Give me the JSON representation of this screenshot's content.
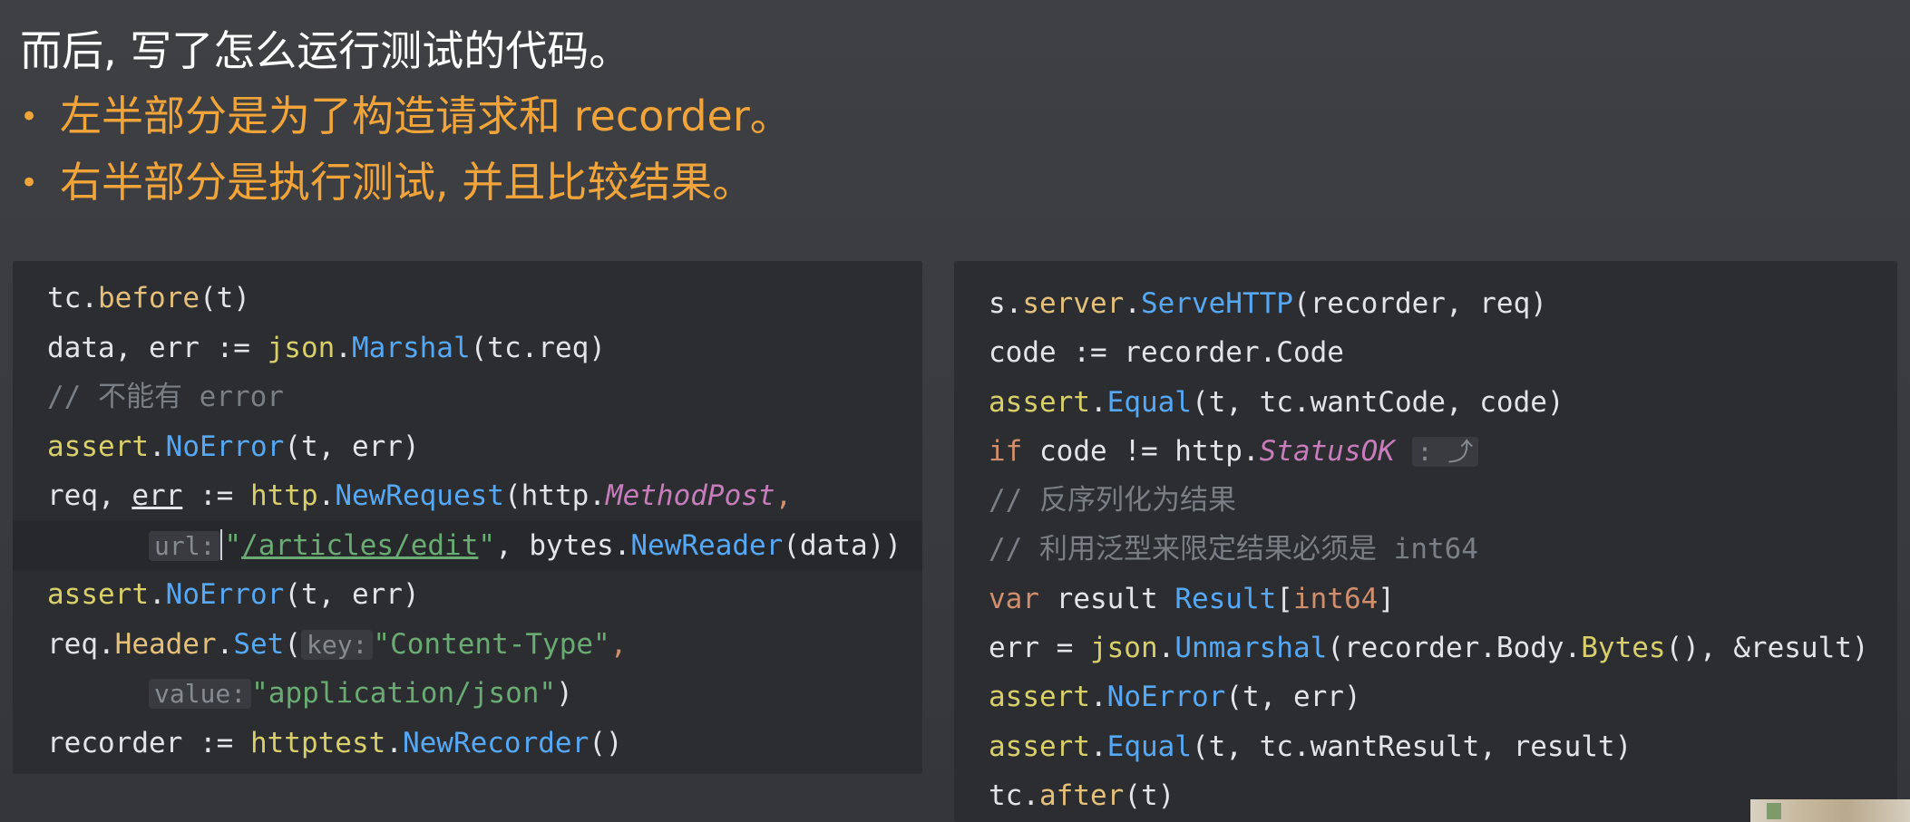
{
  "slide": {
    "heading": "而后, 写了怎么运行测试的代码。",
    "bullets": [
      {
        "bullet": "•",
        "text": "左半部分是为了构造请求和 recorder。"
      },
      {
        "bullet": "•",
        "text": "右半部分是执行测试, 并且比较结果。"
      }
    ]
  },
  "colors": {
    "accent_orange": "#f0a43a",
    "panel_bg": "#2b2d30",
    "keyword": "#cf8e6d",
    "string": "#6aab73",
    "comment": "#7a7e85"
  },
  "left_code": {
    "l1": {
      "a": "tc.",
      "b": "before",
      "c": "(t)"
    },
    "l2": {
      "a": "data, err := ",
      "b": "json",
      "c": ".",
      "d": "Marshal",
      "e": "(tc.req)"
    },
    "l3": {
      "a": "// 不能有 error"
    },
    "l4": {
      "a": "assert",
      "b": ".",
      "c": "NoError",
      "d": "(t, err)"
    },
    "l5": {
      "a": "req, ",
      "b": "err",
      "c": " := ",
      "d": "http",
      "e": ".",
      "f": "NewRequest",
      "g": "(http.",
      "h": "MethodPost",
      "i": ","
    },
    "l6": {
      "hint": "url:",
      "q1": "\"",
      "a": "/articles/edit",
      "q2": "\"",
      "b": ", bytes.",
      "c": "NewReader",
      "d": "(data))"
    },
    "l7": {
      "a": "assert",
      "b": ".",
      "c": "NoError",
      "d": "(t, err)"
    },
    "l8": {
      "a": "req.",
      "b": "Header",
      "c": ".",
      "d": "Set",
      "e": "(",
      "hint": "key:",
      "f": "\"Content-Type\"",
      "g": ","
    },
    "l9": {
      "hint": "value:",
      "a": "\"application/json\"",
      "b": ")"
    },
    "l10": {
      "a": "recorder := ",
      "b": "httptest",
      "c": ".",
      "d": "NewRecorder",
      "e": "()"
    }
  },
  "right_code": {
    "r1": {
      "a": "s.",
      "b": "server",
      "c": ".",
      "d": "ServeHTTP",
      "e": "(recorder, req)"
    },
    "r2": {
      "a": "code := recorder.",
      "b": "Code"
    },
    "r3": {
      "a": "assert",
      "b": ".",
      "c": "Equal",
      "d": "(t, tc.wantCode, code)"
    },
    "r4": {
      "a": "if",
      "b": " code != http.",
      "c": "StatusOK",
      "hint": ":",
      "arrow": "⤴"
    },
    "r5": {
      "a": "// 反序列化为结果"
    },
    "r6": {
      "a": "// 利用泛型来限定结果必须是 int64"
    },
    "r7": {
      "a": "var",
      "b": " result ",
      "c": "Result",
      "d": "[",
      "e": "int64",
      "f": "]"
    },
    "r8": {
      "a": "err = ",
      "b": "json",
      "c": ".",
      "d": "Unmarshal",
      "e": "(recorder.Body.",
      "f": "Bytes",
      "g": "(), &result)"
    },
    "r9": {
      "a": "assert",
      "b": ".",
      "c": "NoError",
      "d": "(t, err)"
    },
    "r10": {
      "a": "assert",
      "b": ".",
      "c": "Equal",
      "d": "(t, tc.wantResult, result)"
    },
    "r11": {
      "a": "tc.",
      "b": "after",
      "c": "(t)"
    }
  }
}
